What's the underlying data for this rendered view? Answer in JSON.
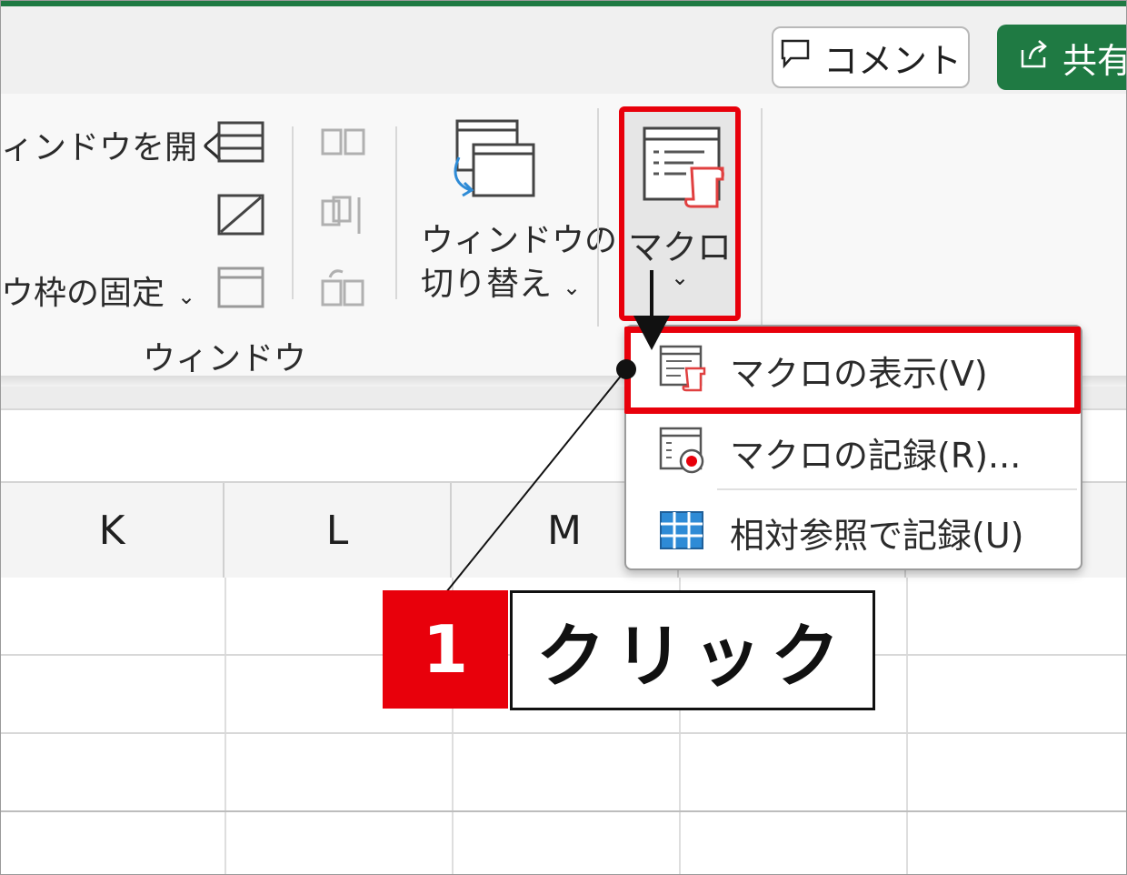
{
  "titlebar": {
    "comment_label": "コメント",
    "share_label": "共有"
  },
  "ribbon": {
    "new_window_label": "ィンドウを開く",
    "freeze_label": "ウ枠の固定",
    "group_label": "ウィンドウ",
    "switch_line1": "ウィンドウの",
    "switch_line2": "切り替え",
    "macro_label": "マクロ"
  },
  "menu": {
    "items": [
      {
        "label": "マクロの表示(V)",
        "icon": "macro-view-icon"
      },
      {
        "label": "マクロの記録(R)...",
        "icon": "macro-record-icon"
      },
      {
        "label": "相対参照で記録(U)",
        "icon": "relative-ref-icon"
      }
    ]
  },
  "columns": [
    "K",
    "L",
    "M"
  ],
  "callout": {
    "number": "1",
    "text": "クリック"
  },
  "colors": {
    "accent_green": "#1f7a43",
    "highlight_red": "#e8000b"
  }
}
